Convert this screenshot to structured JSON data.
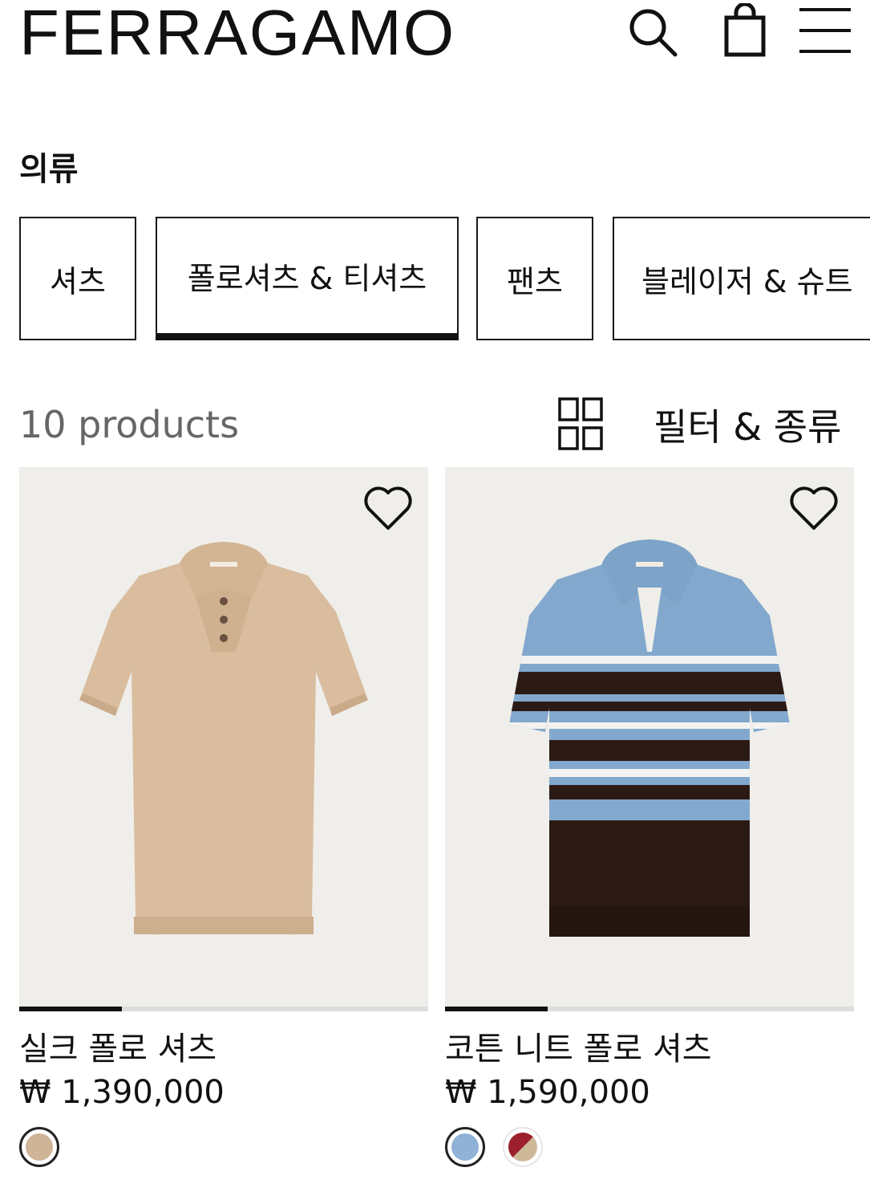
{
  "header": {
    "brand": "FERRAGAMO",
    "icons": [
      "search-icon",
      "shopping-bag-icon",
      "menu-icon"
    ]
  },
  "page": {
    "title": "의류"
  },
  "category_tabs": [
    {
      "label": "셔츠",
      "active": false
    },
    {
      "label": "폴로셔츠 & 티셔츠",
      "active": true
    },
    {
      "label": "팬츠",
      "active": false
    },
    {
      "label": "블레이저 & 슈트",
      "active": false
    }
  ],
  "toolbar": {
    "count": "10 products",
    "filter_label": "필터 & 종류",
    "grid_icon": "grid-view-icon"
  },
  "products": [
    {
      "name": "실크 폴로 셔츠",
      "price": "₩ 1,390,000",
      "image_progress": 0.25,
      "swatches": [
        {
          "color": "#cfb497",
          "selected": true
        }
      ]
    },
    {
      "name": "코튼 니트 폴로 셔츠",
      "price": "₩ 1,590,000",
      "image_progress": 0.25,
      "swatches": [
        {
          "color": "#8fb2d6",
          "selected": true
        },
        {
          "color": "split:#9b1f2c:#cdb89a",
          "selected": false
        }
      ]
    }
  ],
  "colors": {
    "image_bg": "#efeeea",
    "beige_shirt": "#d9bd9e",
    "blue_knit": "#83a8cd",
    "brown_knit": "#2b1a14"
  }
}
